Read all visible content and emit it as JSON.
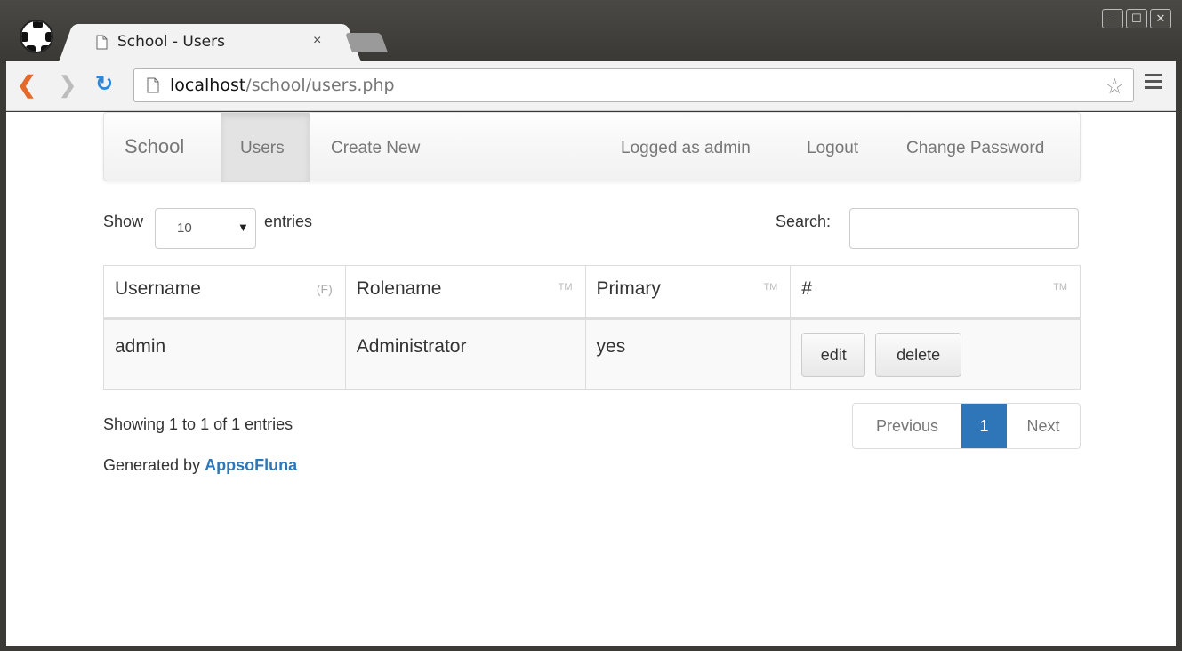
{
  "browser": {
    "tab_title": "School - Users",
    "tab_close": "×",
    "url_host": "localhost",
    "url_path": "/school/users.php",
    "window_buttons": [
      "–",
      "☐",
      "✕"
    ]
  },
  "navbar": {
    "brand": "School",
    "users": "Users",
    "create_new": "Create New",
    "logged_as": "Logged as admin",
    "logout": "Logout",
    "change_password": "Change Password"
  },
  "controls": {
    "show": "Show",
    "entries_value": "10",
    "entries": "entries",
    "search": "Search:",
    "search_value": ""
  },
  "table": {
    "headers": [
      {
        "label": "Username",
        "sort": "(F)"
      },
      {
        "label": "Rolename",
        "sort": "TM"
      },
      {
        "label": "Primary",
        "sort": "TM"
      },
      {
        "label": "#",
        "sort": "TM"
      }
    ],
    "rows": [
      {
        "username": "admin",
        "rolename": "Administrator",
        "primary": "yes",
        "edit": "edit",
        "delete": "delete"
      }
    ]
  },
  "footer": {
    "info": "Showing 1 to 1 of 1 entries",
    "previous": "Previous",
    "page": "1",
    "next": "Next",
    "generated_by": "Generated by",
    "brand_link": "AppsoFluna"
  },
  "colors": {
    "accent": "#2e76b7",
    "chrome": "#3b3a36"
  }
}
